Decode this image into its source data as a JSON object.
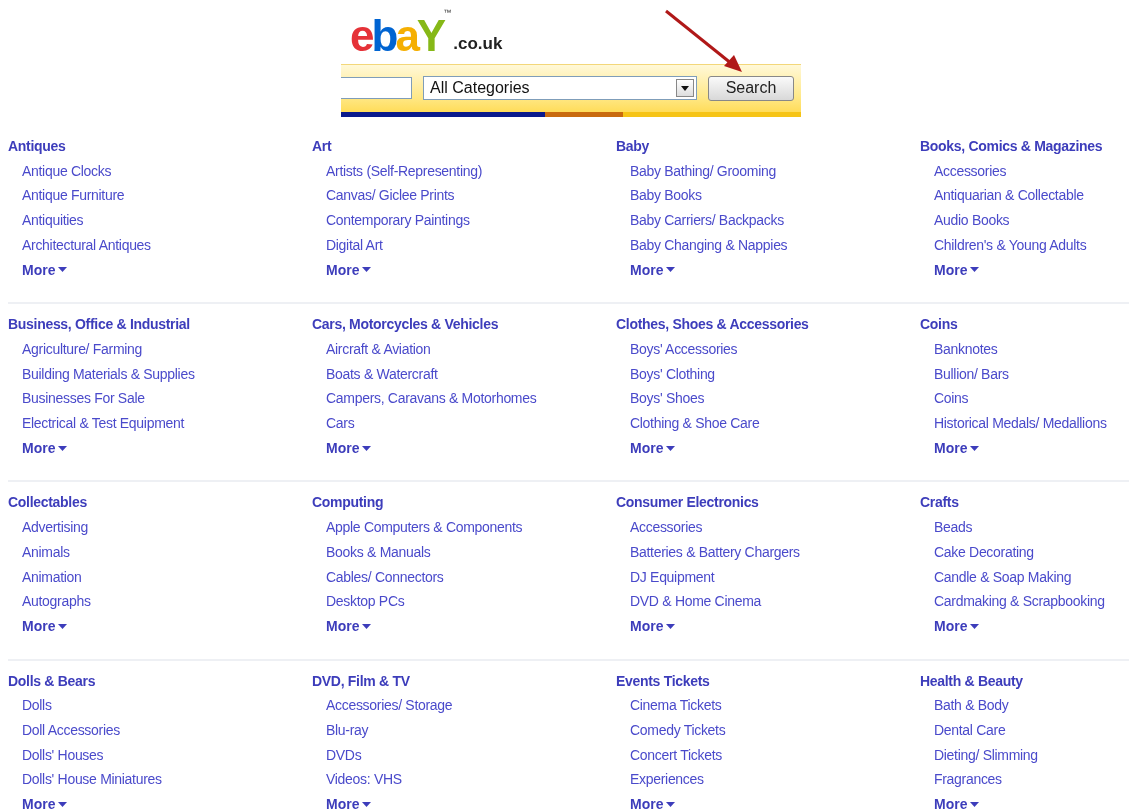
{
  "logo": {
    "letters": [
      {
        "char": "e",
        "color": "#e53238"
      },
      {
        "char": "b",
        "color": "#0064d2"
      },
      {
        "char": "a",
        "color": "#f5af02"
      },
      {
        "char": "Y",
        "color": "#86b817"
      }
    ],
    "trademark": "™",
    "suffix": ".co.uk"
  },
  "search": {
    "category": "All Categories",
    "button": "Search"
  },
  "sections": [
    {
      "title": "Antiques",
      "items": [
        "Antique Clocks",
        "Antique Furniture",
        "Antiquities",
        "Architectural Antiques"
      ],
      "more": "More"
    },
    {
      "title": "Art",
      "items": [
        "Artists (Self-Representing)",
        "Canvas/ Giclee Prints",
        "Contemporary Paintings",
        "Digital Art"
      ],
      "more": "More"
    },
    {
      "title": "Baby",
      "items": [
        "Baby Bathing/ Grooming",
        "Baby Books",
        "Baby Carriers/ Backpacks",
        "Baby Changing & Nappies"
      ],
      "more": "More"
    },
    {
      "title": "Books, Comics & Magazines",
      "items": [
        "Accessories",
        "Antiquarian & Collectable",
        "Audio Books",
        "Children's & Young Adults"
      ],
      "more": "More"
    },
    {
      "title": "Business, Office & Industrial",
      "items": [
        "Agriculture/ Farming",
        "Building Materials & Supplies",
        "Businesses For Sale",
        "Electrical & Test Equipment"
      ],
      "more": "More"
    },
    {
      "title": "Cars, Motorcycles & Vehicles",
      "items": [
        "Aircraft & Aviation",
        "Boats & Watercraft",
        "Campers, Caravans & Motorhomes",
        "Cars"
      ],
      "more": "More"
    },
    {
      "title": "Clothes, Shoes & Accessories",
      "items": [
        "Boys' Accessories",
        "Boys' Clothing",
        "Boys' Shoes",
        "Clothing & Shoe Care"
      ],
      "more": "More"
    },
    {
      "title": "Coins",
      "items": [
        "Banknotes",
        "Bullion/ Bars",
        "Coins",
        "Historical Medals/ Medallions"
      ],
      "more": "More"
    },
    {
      "title": "Collectables",
      "items": [
        "Advertising",
        "Animals",
        "Animation",
        "Autographs"
      ],
      "more": "More"
    },
    {
      "title": "Computing",
      "items": [
        "Apple Computers & Components",
        "Books & Manuals",
        "Cables/ Connectors",
        "Desktop PCs"
      ],
      "more": "More"
    },
    {
      "title": "Consumer Electronics",
      "items": [
        "Accessories",
        "Batteries & Battery Chargers",
        "DJ Equipment",
        "DVD & Home Cinema"
      ],
      "more": "More"
    },
    {
      "title": "Crafts",
      "items": [
        "Beads",
        "Cake Decorating",
        "Candle & Soap Making",
        "Cardmaking & Scrapbooking"
      ],
      "more": "More"
    },
    {
      "title": "Dolls & Bears",
      "items": [
        "Dolls",
        "Doll Accessories",
        "Dolls' Houses",
        "Dolls' House Miniatures"
      ],
      "more": "More"
    },
    {
      "title": "DVD, Film & TV",
      "items": [
        "Accessories/ Storage",
        "Blu-ray",
        "DVDs",
        "Videos: VHS"
      ],
      "more": "More"
    },
    {
      "title": "Events Tickets",
      "items": [
        "Cinema Tickets",
        "Comedy Tickets",
        "Concert Tickets",
        "Experiences"
      ],
      "more": "More"
    },
    {
      "title": "Health & Beauty",
      "items": [
        "Bath & Body",
        "Dental Care",
        "Dieting/ Slimming",
        "Fragrances"
      ],
      "more": "More"
    }
  ]
}
